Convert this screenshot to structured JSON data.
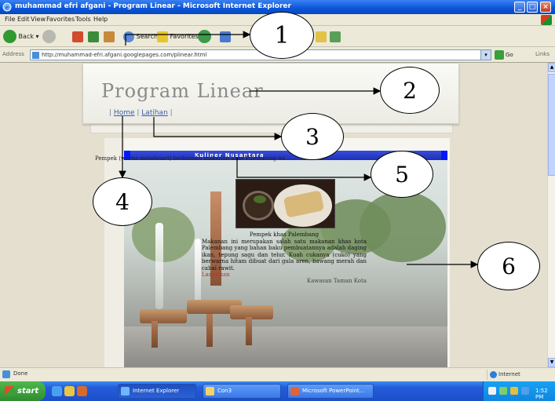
{
  "window": {
    "title": "muhammad efri afgani - Program Linear - Microsoft Internet Explorer",
    "minimize_icon": "minimize-icon",
    "maximize_icon": "maximize-icon",
    "close_icon": "close-icon"
  },
  "menu": [
    "File",
    "Edit",
    "View",
    "Favorites",
    "Tools",
    "Help"
  ],
  "toolbar": {
    "back_label": "Back",
    "search_label": "Search",
    "favorites_label": "Favorites"
  },
  "address": {
    "label": "Address",
    "url": "http://muhammad-efri.afgani.googlepages.com/plinear.html",
    "go_label": "Go",
    "links_label": "Links"
  },
  "page": {
    "site_title": "Program Linear",
    "nav": {
      "items": [
        "Home",
        "Latihan"
      ],
      "separator": "|"
    },
    "section_title": "Kuliner Nusantara",
    "intro_text": "Pempek (warna mendasari) berbumbu makanan khas Palembang ini",
    "lead_text": "Pempek khas Palembang",
    "article_text": "Makanan ini merupakan salah satu makanan khas kota Palembang yang bahan baku pembuatannya adalah daging ikan, tepung sagu dan telur. Kuah cukanya (cuko) yang berwarna hitam dibuat dari gula aren, bawang merah dan cabai rawit.",
    "more_link": "Lanjutkan",
    "image_caption": "Kawasan Taman Kota"
  },
  "annotations": [
    {
      "number": "1",
      "target": "address-bar"
    },
    {
      "number": "2",
      "target": "site-title"
    },
    {
      "number": "3",
      "target": "latihan-link"
    },
    {
      "number": "4",
      "target": "home-link"
    },
    {
      "number": "5",
      "target": "section-bar"
    },
    {
      "number": "6",
      "target": "content-area"
    }
  ],
  "statusbar": {
    "status": "Done",
    "zone": "Internet"
  },
  "taskbar": {
    "start_label": "start",
    "items": [
      "Internet Explorer",
      "Con3",
      "Microsoft PowerPoint..."
    ],
    "clock": "1:52 PM"
  },
  "colors": {
    "titlebar": "#0a55d8",
    "section_bar": "#1d2fb8",
    "link": "#3a5ea8",
    "more_link": "#c0302a",
    "taskbar": "#245ddb"
  }
}
